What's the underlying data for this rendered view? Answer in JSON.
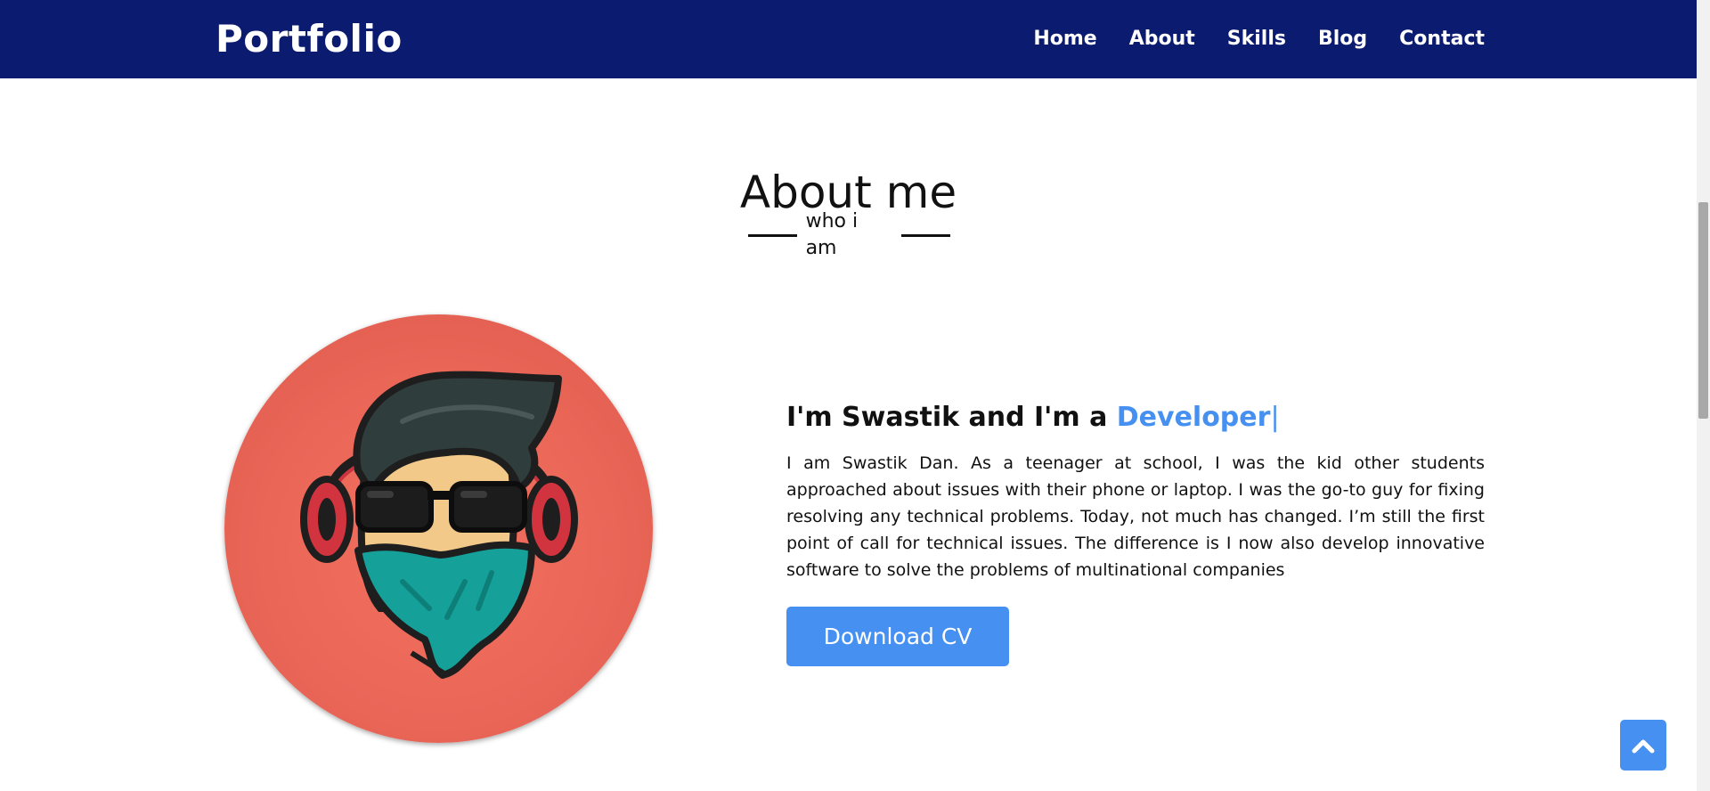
{
  "navbar": {
    "brand": "Portfolio",
    "links": [
      "Home",
      "About",
      "Skills",
      "Blog",
      "Contact"
    ],
    "background_color": "#0b1b6f"
  },
  "about": {
    "title": "About me",
    "subtitle": "who i am",
    "intro_prefix": "I'm Swastik and I'm a ",
    "role": "Developer",
    "cursor": "|",
    "bio": "I am Swastik Dan. As a teenager at school, I was the kid other students approached about issues with their phone or laptop. I was the go-to guy for fixing resolving any technical problems. Today, not much has changed. I’m still the first point of call for technical issues. The difference is I now also develop innovative software to solve the problems of multinational companies",
    "download_label": "Download CV",
    "accent_color": "#4590f0"
  },
  "avatar": {
    "icon": "masked-developer-avatar-icon",
    "background_color": "#ea6657"
  },
  "scroll_top": {
    "icon": "chevron-up-icon"
  }
}
